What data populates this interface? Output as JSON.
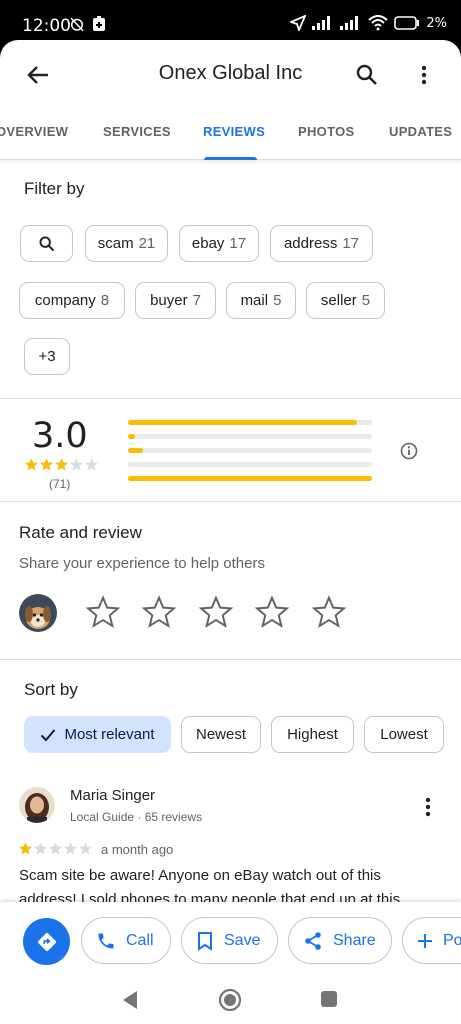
{
  "status_bar": {
    "time": "12:00",
    "battery_text": "2%"
  },
  "header": {
    "title": "Onex Global Inc"
  },
  "tabs": [
    {
      "label": "OVERVIEW"
    },
    {
      "label": "SERVICES"
    },
    {
      "label": "REVIEWS"
    },
    {
      "label": "PHOTOS"
    },
    {
      "label": "UPDATES"
    }
  ],
  "active_tab": "REVIEWS",
  "filter": {
    "heading": "Filter by",
    "chips": [
      {
        "label": "scam",
        "count": "21"
      },
      {
        "label": "ebay",
        "count": "17"
      },
      {
        "label": "address",
        "count": "17"
      },
      {
        "label": "company",
        "count": "8"
      },
      {
        "label": "buyer",
        "count": "7"
      },
      {
        "label": "mail",
        "count": "5"
      },
      {
        "label": "seller",
        "count": "5"
      }
    ],
    "more_label": "+3"
  },
  "summary": {
    "rating": "3.0",
    "star_rating": 3,
    "count": "(71)",
    "distribution": [
      {
        "stars": 5,
        "fraction": 0.94
      },
      {
        "stars": 4,
        "fraction": 0.03
      },
      {
        "stars": 3,
        "fraction": 0.06
      },
      {
        "stars": 2,
        "fraction": 0.0
      },
      {
        "stars": 1,
        "fraction": 1.0
      }
    ]
  },
  "rate": {
    "title": "Rate and review",
    "subtitle": "Share your experience to help others"
  },
  "sort": {
    "heading": "Sort by",
    "options": [
      {
        "label": "Most relevant",
        "selected": true
      },
      {
        "label": "Newest",
        "selected": false
      },
      {
        "label": "Highest",
        "selected": false
      },
      {
        "label": "Lowest",
        "selected": false
      }
    ]
  },
  "review": {
    "author": "Maria Singer",
    "meta": "Local Guide · 65 reviews",
    "stars": 1,
    "date": "a month ago",
    "text": "Scam site be aware! Anyone on eBay watch out of this address! I sold phones to many people that end up at this"
  },
  "actions": {
    "call": "Call",
    "save": "Save",
    "share": "Share",
    "post": "Po"
  },
  "colors": {
    "accent": "#1a73e8",
    "star": "#fbbc04",
    "selected_chip_bg": "#d3e3fd"
  }
}
